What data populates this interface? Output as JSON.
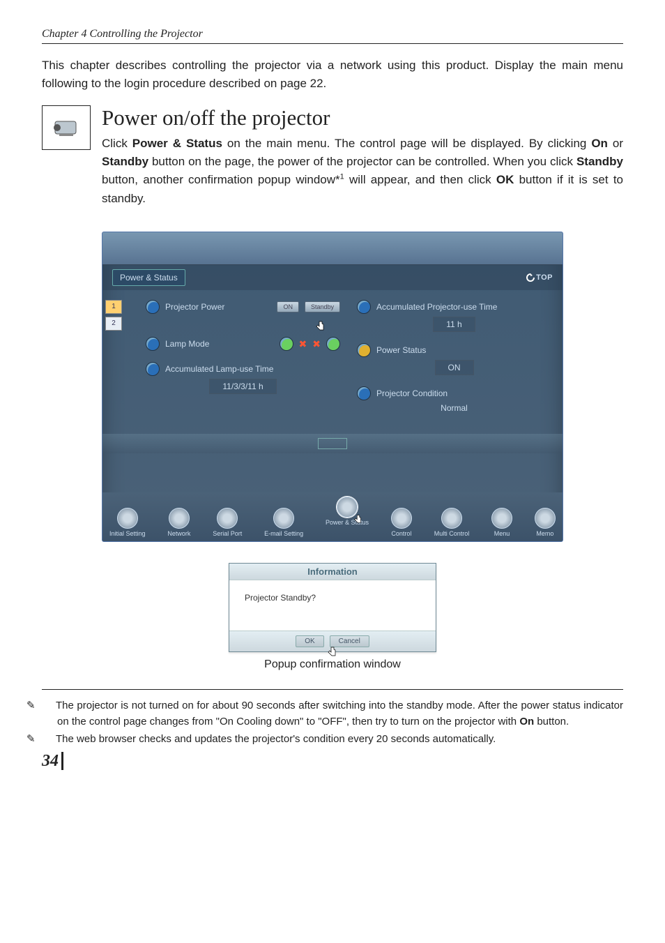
{
  "chapter_header": "Chapter 4 Controlling the Projector",
  "intro": "This chapter describes controlling the projector via a network using this product. Display the main menu following to the login procedure described on page 22.",
  "section": {
    "title": "Power on/off the projector",
    "para_prefix": "Click ",
    "b1": "Power & Status",
    "t1": " on the main menu. The control page will be displayed. By clicking ",
    "b2": "On",
    "t2": " or ",
    "b3": "Standby",
    "t3": " button on the page, the power of the projector can be controlled. When you click ",
    "b4": "Standby",
    "t4": " button, another confirmation popup window*",
    "sup": "1",
    "t5": " will appear, and then click ",
    "b5": "OK",
    "t6": " button if it is set to standby."
  },
  "screenshot": {
    "title": "Power & Status",
    "top_link": "TOP",
    "tabs": [
      "1",
      "2"
    ],
    "left": {
      "row1_label": "Projector Power",
      "row1_btn_on": "ON",
      "row1_btn_standby": "Standby",
      "row2_label": "Lamp Mode",
      "row3_label": "Accumulated Lamp-use Time",
      "row3_value": "11/3/3/11 h"
    },
    "right": {
      "row1_label": "Accumulated Projector-use Time",
      "row1_value": "11 h",
      "row2_label": "Power Status",
      "row2_value": "ON",
      "row3_label": "Projector Condition",
      "row3_value": "Normal"
    },
    "nav": [
      "Initial Setting",
      "Network",
      "Serial Port",
      "E-mail Setting",
      "Power & Status",
      "Control",
      "Multi Control",
      "Menu",
      "Memo"
    ]
  },
  "dialog": {
    "title": "Information",
    "message": "Projector Standby?",
    "ok": "OK",
    "cancel": "Cancel",
    "caption": "Popup confirmation window"
  },
  "footnotes": {
    "note1_a": "The projector is not turned on for about 90 seconds after switching into the standby mode. After the power status indicator on the control page changes from \"On Cooling down\" to \"OFF\", then try to turn on the projector with ",
    "note1_b": "On",
    "note1_c": " button.",
    "note2": "The web browser checks and updates the projector's condition every 20 seconds automatically."
  },
  "page_number": "34"
}
